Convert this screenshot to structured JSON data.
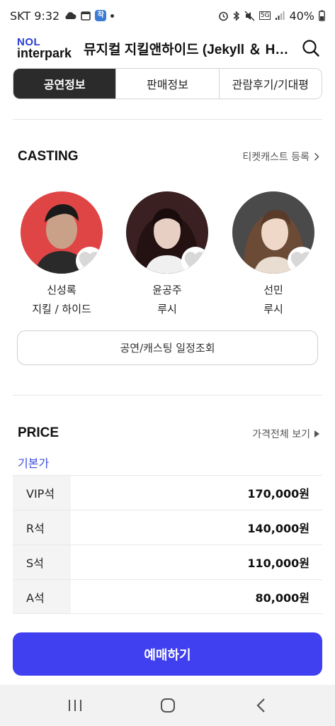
{
  "status": {
    "carrier_time": "SKT 9:32",
    "app_icon_label": "작",
    "network": "5G",
    "battery": "40%"
  },
  "header": {
    "logo_top": "NOL",
    "logo_bottom": "interpark",
    "title": "뮤지컬 지킬앤하이드 (Jekyll ＆ Hyde)"
  },
  "tabs": [
    {
      "label": "공연정보",
      "active": true
    },
    {
      "label": "판매정보",
      "active": false
    },
    {
      "label": "관람후기/기대평",
      "active": false
    }
  ],
  "casting": {
    "title": "CASTING",
    "link": "티켓캐스트 등록",
    "members": [
      {
        "name": "신성록",
        "role": "지킬 / 하이드",
        "bg": "#e04545"
      },
      {
        "name": "윤공주",
        "role": "루시",
        "bg": "#2b1c1c"
      },
      {
        "name": "선민",
        "role": "루시",
        "bg": "#4a4a4a"
      }
    ],
    "schedule_button": "공연/캐스팅 일정조회"
  },
  "price": {
    "title": "PRICE",
    "link": "가격전체 보기",
    "subtitle": "기본가",
    "rows": [
      {
        "seat": "VIP석",
        "price": "170,000원"
      },
      {
        "seat": "R석",
        "price": "140,000원"
      },
      {
        "seat": "S석",
        "price": "110,000원"
      },
      {
        "seat": "A석",
        "price": "80,000원"
      }
    ]
  },
  "book_button": "예매하기",
  "colors": {
    "accent": "#4040f0",
    "brand": "#2a3bd6",
    "sub_link": "#3b4fe0"
  }
}
